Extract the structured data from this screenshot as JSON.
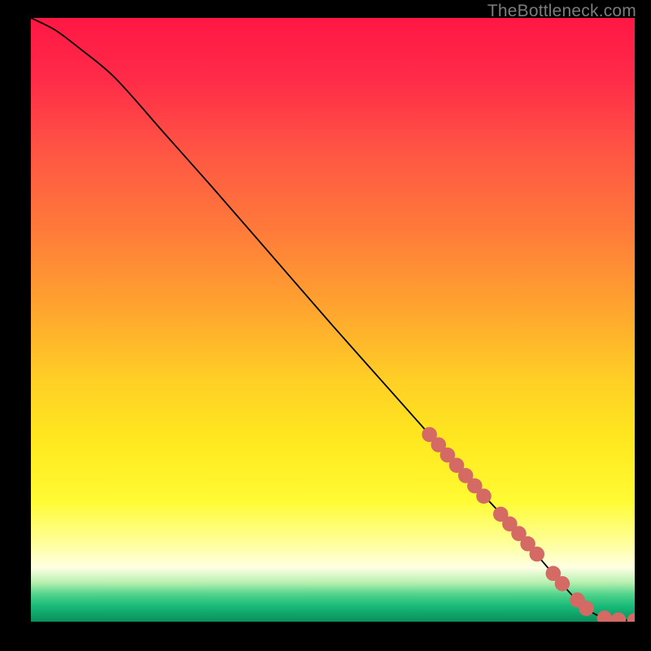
{
  "attribution": "TheBottleneck.com",
  "colors": {
    "dot": "#d46a63",
    "line": "#000000"
  },
  "chart_data": {
    "type": "line",
    "title": "",
    "xlabel": "",
    "ylabel": "",
    "xlim": [
      0,
      100
    ],
    "ylim": [
      0,
      100
    ],
    "grid": false,
    "legend": false,
    "gradient_stops": [
      {
        "pos": 0.0,
        "color": "#ff1744"
      },
      {
        "pos": 0.1,
        "color": "#ff2b48"
      },
      {
        "pos": 0.22,
        "color": "#ff5544"
      },
      {
        "pos": 0.35,
        "color": "#ff7a3a"
      },
      {
        "pos": 0.48,
        "color": "#ffa42f"
      },
      {
        "pos": 0.6,
        "color": "#ffcf25"
      },
      {
        "pos": 0.7,
        "color": "#ffe81f"
      },
      {
        "pos": 0.8,
        "color": "#fffb33"
      },
      {
        "pos": 0.87,
        "color": "#ffff9b"
      },
      {
        "pos": 0.91,
        "color": "#ffffe4"
      },
      {
        "pos": 0.935,
        "color": "#b8f0b0"
      },
      {
        "pos": 0.955,
        "color": "#4fd38a"
      },
      {
        "pos": 0.975,
        "color": "#17b978"
      },
      {
        "pos": 1.0,
        "color": "#0a8f5b"
      }
    ],
    "series": [
      {
        "name": "curve",
        "x": [
          0,
          4,
          8,
          14,
          22,
          30,
          40,
          50,
          58,
          66,
          74,
          80,
          86,
          90,
          92.5,
          95,
          97.5,
          100
        ],
        "y": [
          100,
          98,
          95,
          90,
          81,
          72,
          60.5,
          49,
          40,
          31,
          22,
          15.5,
          8.5,
          4,
          1.8,
          0.6,
          0.3,
          0.2
        ]
      }
    ],
    "dots": [
      {
        "x": 66.0,
        "y": 31.0
      },
      {
        "x": 67.5,
        "y": 29.3
      },
      {
        "x": 69.0,
        "y": 27.6
      },
      {
        "x": 70.5,
        "y": 25.9
      },
      {
        "x": 72.0,
        "y": 24.2
      },
      {
        "x": 73.5,
        "y": 22.5
      },
      {
        "x": 75.0,
        "y": 20.8
      },
      {
        "x": 77.8,
        "y": 17.8
      },
      {
        "x": 79.3,
        "y": 16.2
      },
      {
        "x": 80.8,
        "y": 14.6
      },
      {
        "x": 82.3,
        "y": 12.9
      },
      {
        "x": 83.8,
        "y": 11.2
      },
      {
        "x": 86.5,
        "y": 8.0
      },
      {
        "x": 88.0,
        "y": 6.3
      },
      {
        "x": 90.5,
        "y": 3.6
      },
      {
        "x": 92.0,
        "y": 2.2
      },
      {
        "x": 95.0,
        "y": 0.6
      },
      {
        "x": 97.3,
        "y": 0.3
      },
      {
        "x": 100.0,
        "y": 0.2
      }
    ]
  }
}
